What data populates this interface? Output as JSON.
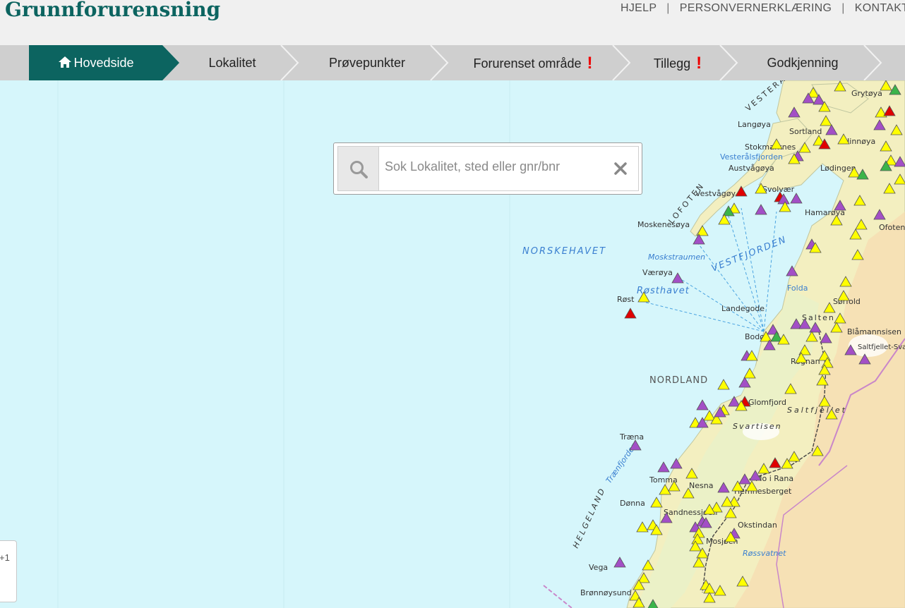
{
  "app": {
    "title": "Grunnforurensning"
  },
  "top_links": [
    "HJELP",
    "PERSONVERNERKLÆRING",
    "KONTAKT"
  ],
  "steps": [
    {
      "label": "Hovedside",
      "active": true,
      "warning": false
    },
    {
      "label": "Lokalitet",
      "active": false,
      "warning": false
    },
    {
      "label": "Prøvepunkter",
      "active": false,
      "warning": false
    },
    {
      "label": "Forurenset område",
      "active": false,
      "warning": true
    },
    {
      "label": "Tillegg",
      "active": false,
      "warning": true
    },
    {
      "label": "Godkjenning",
      "active": false,
      "warning": false
    }
  ],
  "search": {
    "placeholder": "Sok Lokalitet, sted eller gnr/bnr",
    "value": ""
  },
  "map": {
    "widget_text": "+1",
    "place_labels": [
      "Grytøya",
      "Langøya",
      "Sortland",
      "Stokmarknes",
      "Hinnøya",
      "Vesterålsfjorden",
      "Austvågøya",
      "Lødingen",
      "Vestvågøy",
      "Svolvær",
      "Hamarøya",
      "Moskenesøya",
      "Ofoten",
      "Moskstraumen",
      "NORSKEHAVET",
      "VESTFJORDEN",
      "Værøya",
      "Røsthavet",
      "Røst",
      "Landegode",
      "Folda",
      "Sørfold",
      "Salten",
      "Bodø",
      "Blåmannsisen",
      "Saltfjellet-Svartisen",
      "Rognan",
      "NORDLAND",
      "Glomfjord",
      "Saltfjellet",
      "Svartisen",
      "Træna",
      "Trænfjorden",
      "Tomma",
      "Mo i Rana",
      "Nesna",
      "Hemnesberget",
      "Dønna",
      "Sandnessjøen",
      "Okstindan",
      "Mosjøen",
      "Røssvatnet",
      "HELGELAND",
      "Vega",
      "Brønnøysund",
      "LOFOTEN",
      "VESTERÅLEN"
    ]
  },
  "colors": {
    "brand": "#0c6460",
    "active_step": "#0c6460",
    "warning": "#e00000",
    "sea": "#d6f6fb",
    "marker_yellow": "#ffff00",
    "marker_purple": "#a34fc6",
    "marker_red": "#e00000",
    "marker_green": "#3bb44a"
  },
  "icons": [
    "home-icon",
    "search-icon",
    "clear-icon",
    "warning-icon"
  ]
}
